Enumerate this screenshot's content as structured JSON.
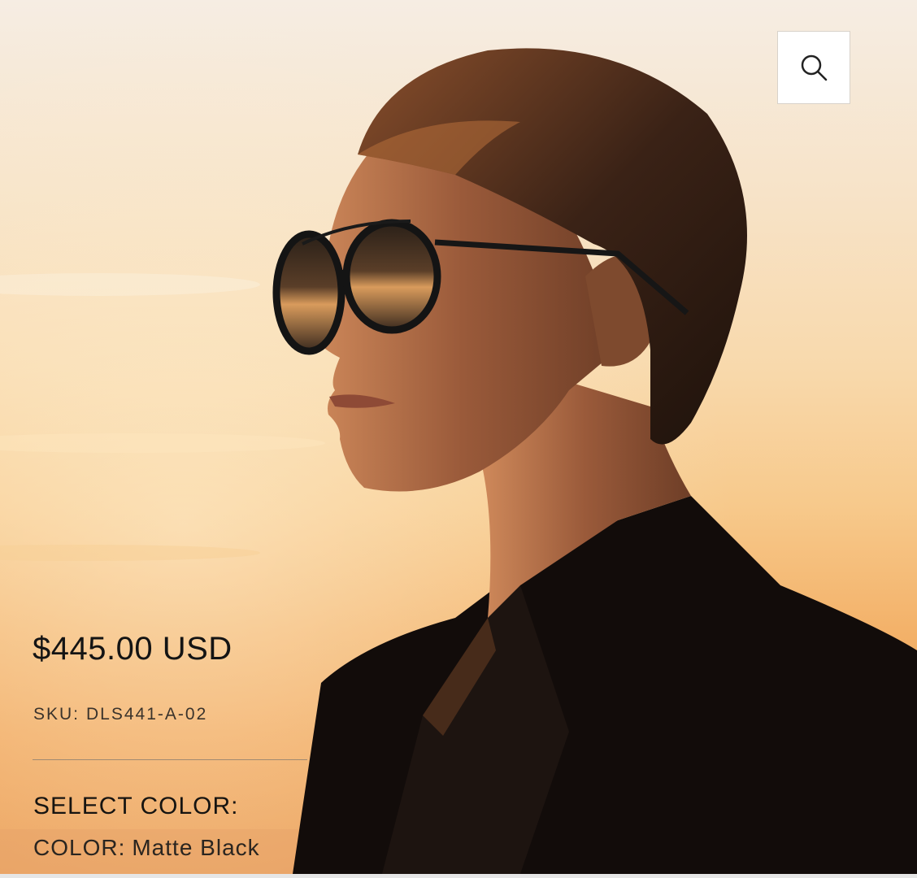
{
  "product": {
    "price": "$445.00 USD",
    "sku_label": "SKU:",
    "sku_value": "DLS441-A-02",
    "select_color_label": "SELECT COLOR:",
    "color_label": "COLOR:",
    "color_value": "Matte Black"
  },
  "header": {
    "search_icon": "search-icon"
  },
  "colors": {
    "text_dark": "#141414",
    "search_bg": "#ffffff"
  }
}
